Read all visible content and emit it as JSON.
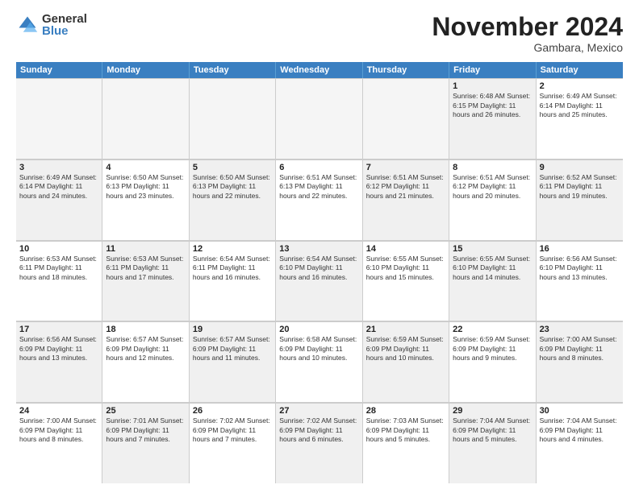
{
  "logo": {
    "general": "General",
    "blue": "Blue"
  },
  "title": "November 2024",
  "location": "Gambara, Mexico",
  "header_days": [
    "Sunday",
    "Monday",
    "Tuesday",
    "Wednesday",
    "Thursday",
    "Friday",
    "Saturday"
  ],
  "weeks": [
    [
      {
        "day": "",
        "empty": true
      },
      {
        "day": "",
        "empty": true
      },
      {
        "day": "",
        "empty": true
      },
      {
        "day": "",
        "empty": true
      },
      {
        "day": "",
        "empty": true
      },
      {
        "day": "1",
        "info": "Sunrise: 6:48 AM\nSunset: 6:15 PM\nDaylight: 11 hours\nand 26 minutes.",
        "shaded": true
      },
      {
        "day": "2",
        "info": "Sunrise: 6:49 AM\nSunset: 6:14 PM\nDaylight: 11 hours\nand 25 minutes.",
        "shaded": false
      }
    ],
    [
      {
        "day": "3",
        "info": "Sunrise: 6:49 AM\nSunset: 6:14 PM\nDaylight: 11 hours\nand 24 minutes.",
        "shaded": true
      },
      {
        "day": "4",
        "info": "Sunrise: 6:50 AM\nSunset: 6:13 PM\nDaylight: 11 hours\nand 23 minutes.",
        "shaded": false
      },
      {
        "day": "5",
        "info": "Sunrise: 6:50 AM\nSunset: 6:13 PM\nDaylight: 11 hours\nand 22 minutes.",
        "shaded": true
      },
      {
        "day": "6",
        "info": "Sunrise: 6:51 AM\nSunset: 6:13 PM\nDaylight: 11 hours\nand 22 minutes.",
        "shaded": false
      },
      {
        "day": "7",
        "info": "Sunrise: 6:51 AM\nSunset: 6:12 PM\nDaylight: 11 hours\nand 21 minutes.",
        "shaded": true
      },
      {
        "day": "8",
        "info": "Sunrise: 6:51 AM\nSunset: 6:12 PM\nDaylight: 11 hours\nand 20 minutes.",
        "shaded": false
      },
      {
        "day": "9",
        "info": "Sunrise: 6:52 AM\nSunset: 6:11 PM\nDaylight: 11 hours\nand 19 minutes.",
        "shaded": true
      }
    ],
    [
      {
        "day": "10",
        "info": "Sunrise: 6:53 AM\nSunset: 6:11 PM\nDaylight: 11 hours\nand 18 minutes.",
        "shaded": false
      },
      {
        "day": "11",
        "info": "Sunrise: 6:53 AM\nSunset: 6:11 PM\nDaylight: 11 hours\nand 17 minutes.",
        "shaded": true
      },
      {
        "day": "12",
        "info": "Sunrise: 6:54 AM\nSunset: 6:11 PM\nDaylight: 11 hours\nand 16 minutes.",
        "shaded": false
      },
      {
        "day": "13",
        "info": "Sunrise: 6:54 AM\nSunset: 6:10 PM\nDaylight: 11 hours\nand 16 minutes.",
        "shaded": true
      },
      {
        "day": "14",
        "info": "Sunrise: 6:55 AM\nSunset: 6:10 PM\nDaylight: 11 hours\nand 15 minutes.",
        "shaded": false
      },
      {
        "day": "15",
        "info": "Sunrise: 6:55 AM\nSunset: 6:10 PM\nDaylight: 11 hours\nand 14 minutes.",
        "shaded": true
      },
      {
        "day": "16",
        "info": "Sunrise: 6:56 AM\nSunset: 6:10 PM\nDaylight: 11 hours\nand 13 minutes.",
        "shaded": false
      }
    ],
    [
      {
        "day": "17",
        "info": "Sunrise: 6:56 AM\nSunset: 6:09 PM\nDaylight: 11 hours\nand 13 minutes.",
        "shaded": true
      },
      {
        "day": "18",
        "info": "Sunrise: 6:57 AM\nSunset: 6:09 PM\nDaylight: 11 hours\nand 12 minutes.",
        "shaded": false
      },
      {
        "day": "19",
        "info": "Sunrise: 6:57 AM\nSunset: 6:09 PM\nDaylight: 11 hours\nand 11 minutes.",
        "shaded": true
      },
      {
        "day": "20",
        "info": "Sunrise: 6:58 AM\nSunset: 6:09 PM\nDaylight: 11 hours\nand 10 minutes.",
        "shaded": false
      },
      {
        "day": "21",
        "info": "Sunrise: 6:59 AM\nSunset: 6:09 PM\nDaylight: 11 hours\nand 10 minutes.",
        "shaded": true
      },
      {
        "day": "22",
        "info": "Sunrise: 6:59 AM\nSunset: 6:09 PM\nDaylight: 11 hours\nand 9 minutes.",
        "shaded": false
      },
      {
        "day": "23",
        "info": "Sunrise: 7:00 AM\nSunset: 6:09 PM\nDaylight: 11 hours\nand 8 minutes.",
        "shaded": true
      }
    ],
    [
      {
        "day": "24",
        "info": "Sunrise: 7:00 AM\nSunset: 6:09 PM\nDaylight: 11 hours\nand 8 minutes.",
        "shaded": false
      },
      {
        "day": "25",
        "info": "Sunrise: 7:01 AM\nSunset: 6:09 PM\nDaylight: 11 hours\nand 7 minutes.",
        "shaded": true
      },
      {
        "day": "26",
        "info": "Sunrise: 7:02 AM\nSunset: 6:09 PM\nDaylight: 11 hours\nand 7 minutes.",
        "shaded": false
      },
      {
        "day": "27",
        "info": "Sunrise: 7:02 AM\nSunset: 6:09 PM\nDaylight: 11 hours\nand 6 minutes.",
        "shaded": true
      },
      {
        "day": "28",
        "info": "Sunrise: 7:03 AM\nSunset: 6:09 PM\nDaylight: 11 hours\nand 5 minutes.",
        "shaded": false
      },
      {
        "day": "29",
        "info": "Sunrise: 7:04 AM\nSunset: 6:09 PM\nDaylight: 11 hours\nand 5 minutes.",
        "shaded": true
      },
      {
        "day": "30",
        "info": "Sunrise: 7:04 AM\nSunset: 6:09 PM\nDaylight: 11 hours\nand 4 minutes.",
        "shaded": false
      }
    ]
  ]
}
